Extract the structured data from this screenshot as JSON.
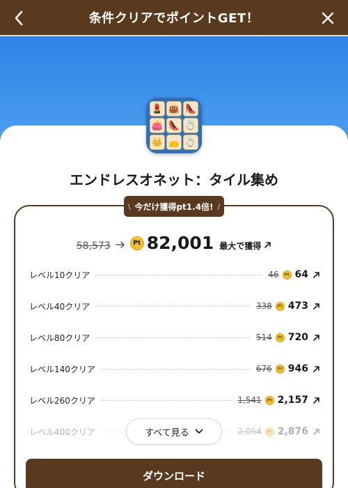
{
  "header": {
    "title": "条件クリアでポイントGET！"
  },
  "app": {
    "name": "エンドレスオネット：タイル集め"
  },
  "badge": {
    "text": "今だけ獲得pt1.4倍!",
    "slash_left": "\\",
    "slash_right": "/"
  },
  "total": {
    "old": "58,573",
    "new": "82,001",
    "suffix": "最大で獲得",
    "pt_label": "Pt"
  },
  "rows": [
    {
      "label": "レベル10クリア",
      "old": "46",
      "new": "64"
    },
    {
      "label": "レベル40クリア",
      "old": "338",
      "new": "473"
    },
    {
      "label": "レベル80クリア",
      "old": "514",
      "new": "720"
    },
    {
      "label": "レベル140クリア",
      "old": "676",
      "new": "946"
    },
    {
      "label": "レベル260クリア",
      "old": "1,541",
      "new": "2,157"
    },
    {
      "label": "レベル400クリア",
      "old": "2,054",
      "new": "2,876"
    }
  ],
  "see_all": {
    "label": "すべて見る"
  },
  "download": {
    "label": "ダウンロード"
  },
  "colors": {
    "brand_brown": "#5a3a1e",
    "hero_blue": "#2e82e5",
    "point_gold": "#f2c12e"
  },
  "icons": {
    "back": "chevron-left-icon",
    "close": "close-icon",
    "arrow": "arrow-right-icon",
    "external": "arrow-up-right-icon",
    "expand": "chevron-down-icon",
    "point": "point-coin-icon"
  }
}
